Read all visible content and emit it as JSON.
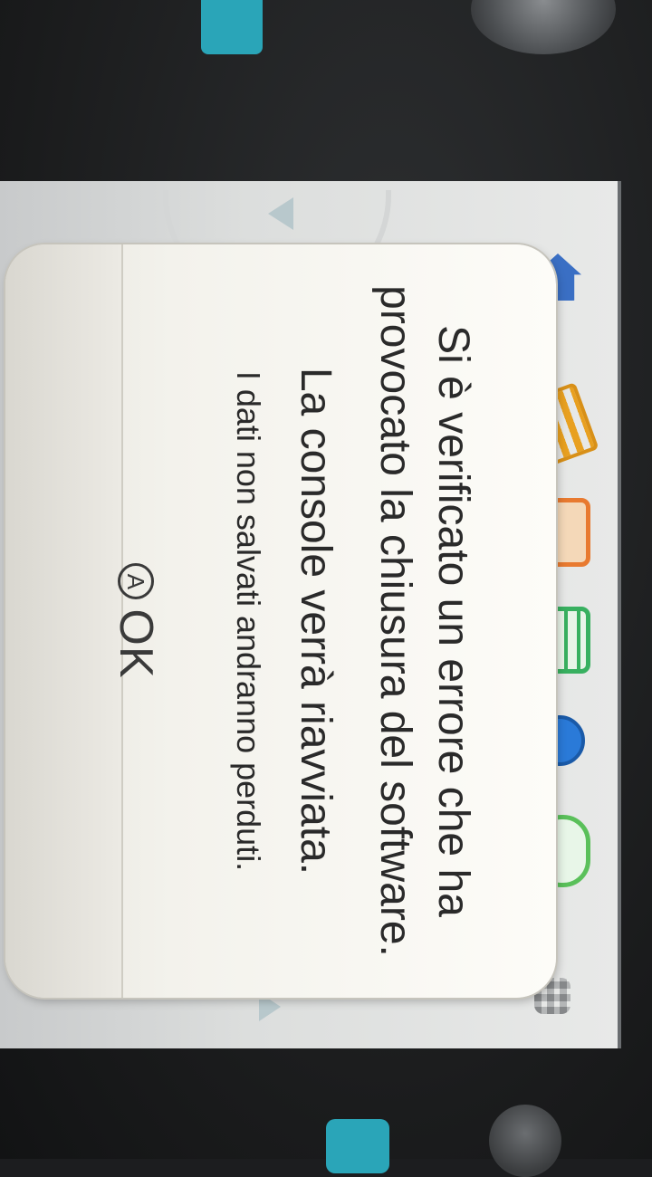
{
  "dialog": {
    "message_line1": "Si è verificato un errore che ha provocato la chiusura del software.",
    "message_line2": "La console verrà riavviata.",
    "message_line3": "I dati non salvati andranno perduti.",
    "ok_button": {
      "icon": "a-button-icon",
      "icon_glyph": "A",
      "label": "OK"
    }
  },
  "home_menu": {
    "icons": [
      "home-icon",
      "notes-icon",
      "gift-icon",
      "list-icon",
      "globe-icon",
      "friends-icon",
      "grid-icon"
    ]
  },
  "colors": {
    "device_teal": "#2aa5b8",
    "dialog_bg": "#fdfcf8",
    "text": "#2a2a2a"
  }
}
